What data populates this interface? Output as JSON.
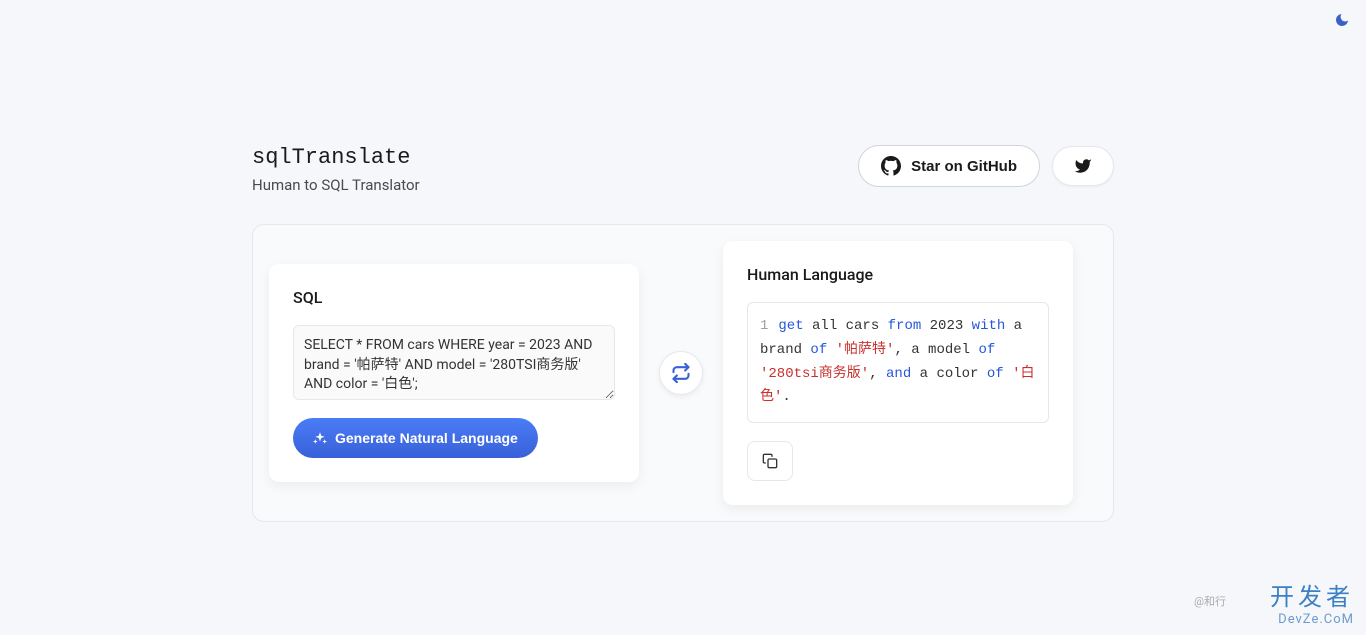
{
  "header": {
    "title": "sqlTranslate",
    "subtitle": "Human to SQL Translator",
    "github_label": "Star on GitHub"
  },
  "left_panel": {
    "title": "SQL",
    "textarea_value": "SELECT * FROM cars WHERE year = 2023 AND brand = '帕萨特' AND model = '280TSI商务版' AND color = '白色';",
    "generate_label": "Generate Natural Language"
  },
  "right_panel": {
    "title": "Human Language",
    "line_number": "1",
    "tokens": {
      "t1": "get",
      "t2": " all cars ",
      "t3": "from",
      "t4": " 2023 ",
      "t5": "with",
      "t6": " a brand ",
      "t7": "of",
      "t8": " ",
      "t9": "'帕萨特'",
      "t10": ", a model ",
      "t11": "of",
      "t12": " ",
      "t13": "'280tsi商务版'",
      "t14": ", ",
      "t15": "and",
      "t16": " a color ",
      "t17": "of",
      "t18": " ",
      "t19": "'白色'",
      "t20": "."
    }
  },
  "watermark": {
    "main": "开发者",
    "sub": "DevZe.CoM",
    "at": "@和行"
  }
}
